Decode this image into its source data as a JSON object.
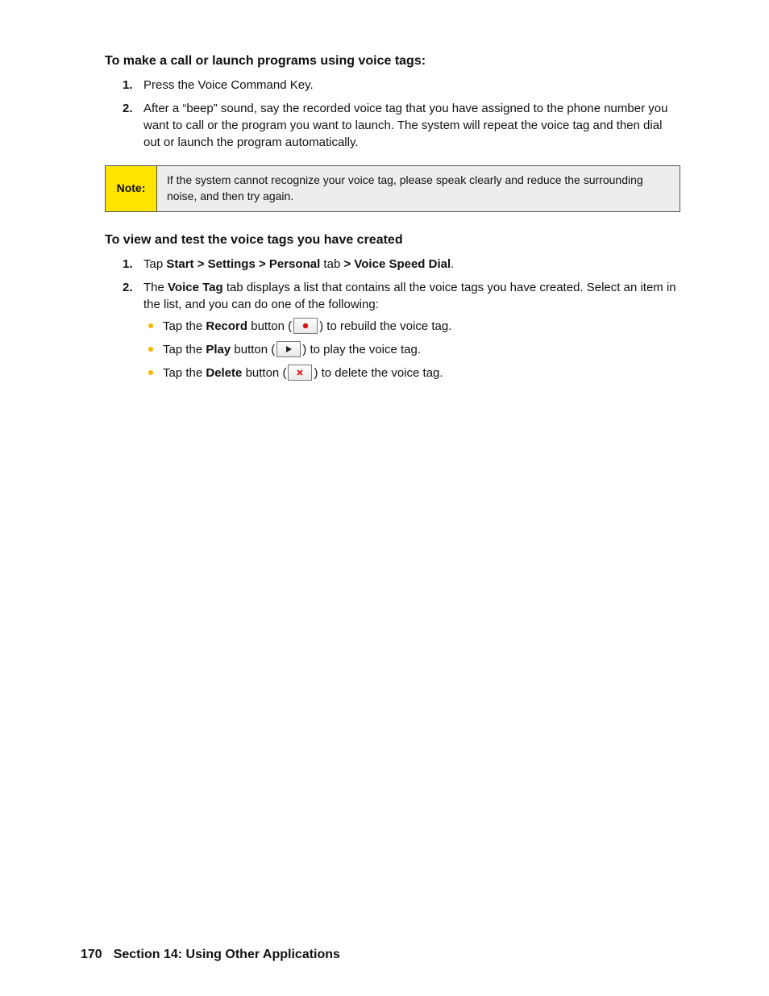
{
  "heading1": "To make a call or launch programs using voice tags:",
  "steps1": {
    "n1": "1.",
    "t1": "Press the Voice Command Key.",
    "n2": "2.",
    "t2": "After a “beep” sound, say the recorded voice tag that you have assigned to the phone number you want to call or the program you want to launch. The system will repeat the voice tag and then dial out or launch the program automatically."
  },
  "note": {
    "label": "Note:",
    "body": "If the system cannot recognize your voice tag, please speak clearly and reduce the surrounding noise, and then try again."
  },
  "heading2": "To view and test the voice tags you have created",
  "steps2": {
    "n1": "1.",
    "t1a": "Tap ",
    "t1b": "Start > Settings > Personal",
    "t1c": " tab ",
    "t1d": "> Voice Speed Dial",
    "t1e": ".",
    "n2": "2.",
    "t2a": "The ",
    "t2b": "Voice Tag",
    "t2c": " tab displays a list that contains all the voice tags you have created. Select an item in the list, and you can do one of the following:"
  },
  "bullets": {
    "b1a": "Tap the ",
    "b1b": "Record",
    "b1c": " button (",
    "b1d": ") to rebuild the voice tag.",
    "b2a": "Tap the ",
    "b2b": "Play",
    "b2c": " button (",
    "b2d": ") to play the voice tag.",
    "b3a": "Tap the ",
    "b3b": "Delete",
    "b3c": " button (",
    "b3d": ") to delete the voice tag."
  },
  "footer": {
    "page": "170",
    "section": "Section 14: Using Other Applications"
  }
}
